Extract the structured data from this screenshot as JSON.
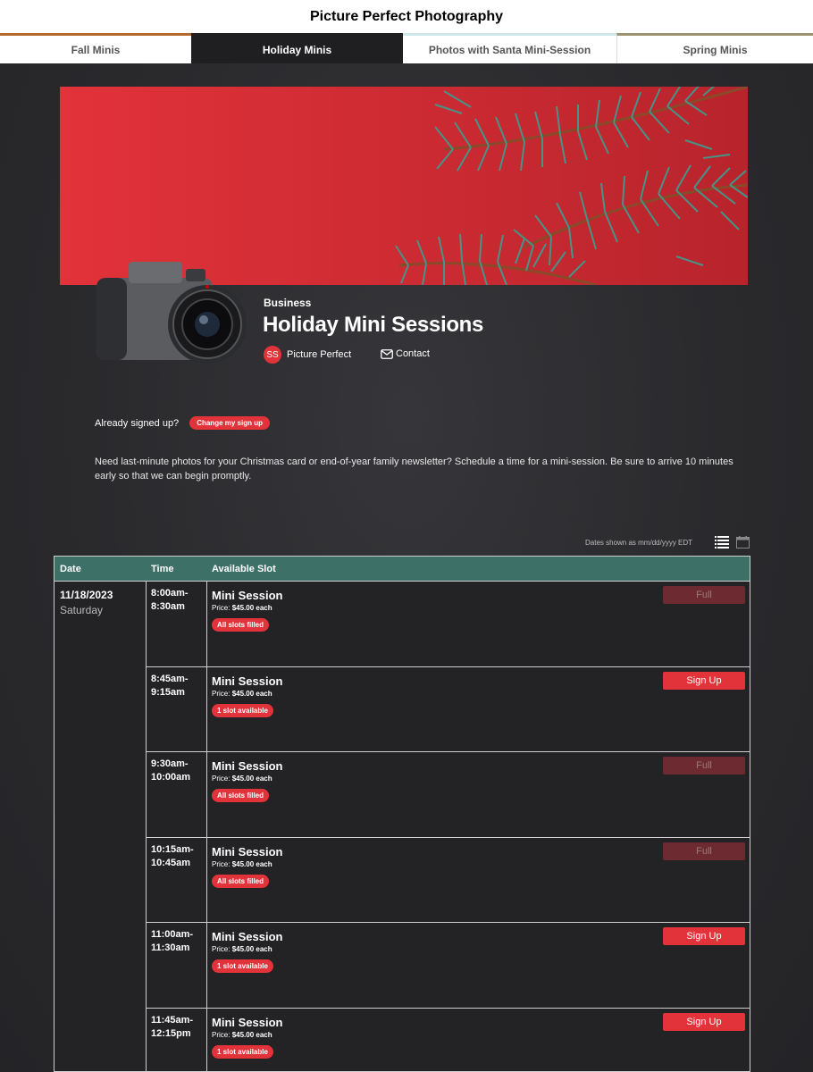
{
  "site": {
    "title": "Picture Perfect Photography"
  },
  "tabs": [
    "Fall Minis",
    "Holiday Minis",
    "Photos with Santa Mini-Session",
    "Spring Minis"
  ],
  "header": {
    "category": "Business",
    "title": "Holiday Mini Sessions",
    "organizer_initials": "SS",
    "organizer_name": "Picture Perfect",
    "contact_label": "Contact"
  },
  "signup": {
    "already_text": "Already signed up?",
    "change_button": "Change my sign up"
  },
  "description": "Need last-minute photos for your Christmas card or end-of-year family newsletter? Schedule a time for a mini-session. Be sure to arrive 10 minutes early so that we can begin promptly.",
  "table": {
    "timezone_note": "Dates shown as mm/dd/yyyy EDT",
    "columns": [
      "Date",
      "Time",
      "Available Slot"
    ],
    "date": "11/18/2023",
    "day": "Saturday",
    "rows": [
      {
        "time_start": "8:00am-",
        "time_end": "8:30am",
        "name": "Mini Session",
        "price_label": "Price:",
        "price": "$45.00 each",
        "status": "All slots filled",
        "action": "Full"
      },
      {
        "time_start": "8:45am-",
        "time_end": "9:15am",
        "name": "Mini Session",
        "price_label": "Price:",
        "price": "$45.00 each",
        "status": "1 slot available",
        "action": "Sign Up"
      },
      {
        "time_start": "9:30am-",
        "time_end": "10:00am",
        "name": "Mini Session",
        "price_label": "Price:",
        "price": "$45.00 each",
        "status": "All slots filled",
        "action": "Full"
      },
      {
        "time_start": "10:15am-",
        "time_end": "10:45am",
        "name": "Mini Session",
        "price_label": "Price:",
        "price": "$45.00 each",
        "status": "All slots filled",
        "action": "Full"
      },
      {
        "time_start": "11:00am-",
        "time_end": "11:30am",
        "name": "Mini Session",
        "price_label": "Price:",
        "price": "$45.00 each",
        "status": "1 slot available",
        "action": "Sign Up"
      },
      {
        "time_start": "11:45am-",
        "time_end": "12:15pm",
        "name": "Mini Session",
        "price_label": "Price:",
        "price": "$45.00 each",
        "status": "1 slot available",
        "action": "Sign Up"
      }
    ]
  },
  "colors": {
    "accent": "#e2323a",
    "header_teal": "#3d7067",
    "background": "#2a2a2d"
  }
}
